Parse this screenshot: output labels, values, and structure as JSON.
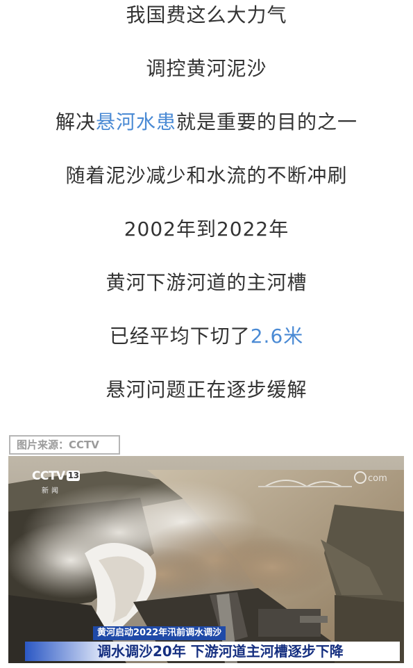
{
  "article": {
    "lines": [
      {
        "text": "我国费这么大力气"
      },
      {
        "text": "调控黄河泥沙"
      },
      {
        "pre": "解决",
        "highlight": "悬河水患",
        "post": "就是重要的目的之一"
      },
      {
        "text": "随着泥沙减少和水流的不断冲刷"
      },
      {
        "text": "2002年到2022年"
      },
      {
        "text": "黄河下游河道的主河槽"
      },
      {
        "pre": "已经平均下切了",
        "highlight": "2.6米"
      },
      {
        "text": "悬河问题正在逐步缓解"
      }
    ],
    "highlight_color": "#4a8ad4"
  },
  "image": {
    "source_label": "图片来源：CCTV",
    "channel_logo": "CCTV",
    "channel_number": "13",
    "channel_sub": "新闻",
    "watermark": "com",
    "caption_top": "黄河启动2022年汛前调水调沙",
    "caption_main": "调水调沙20年 下游河道主河槽逐步下降"
  }
}
